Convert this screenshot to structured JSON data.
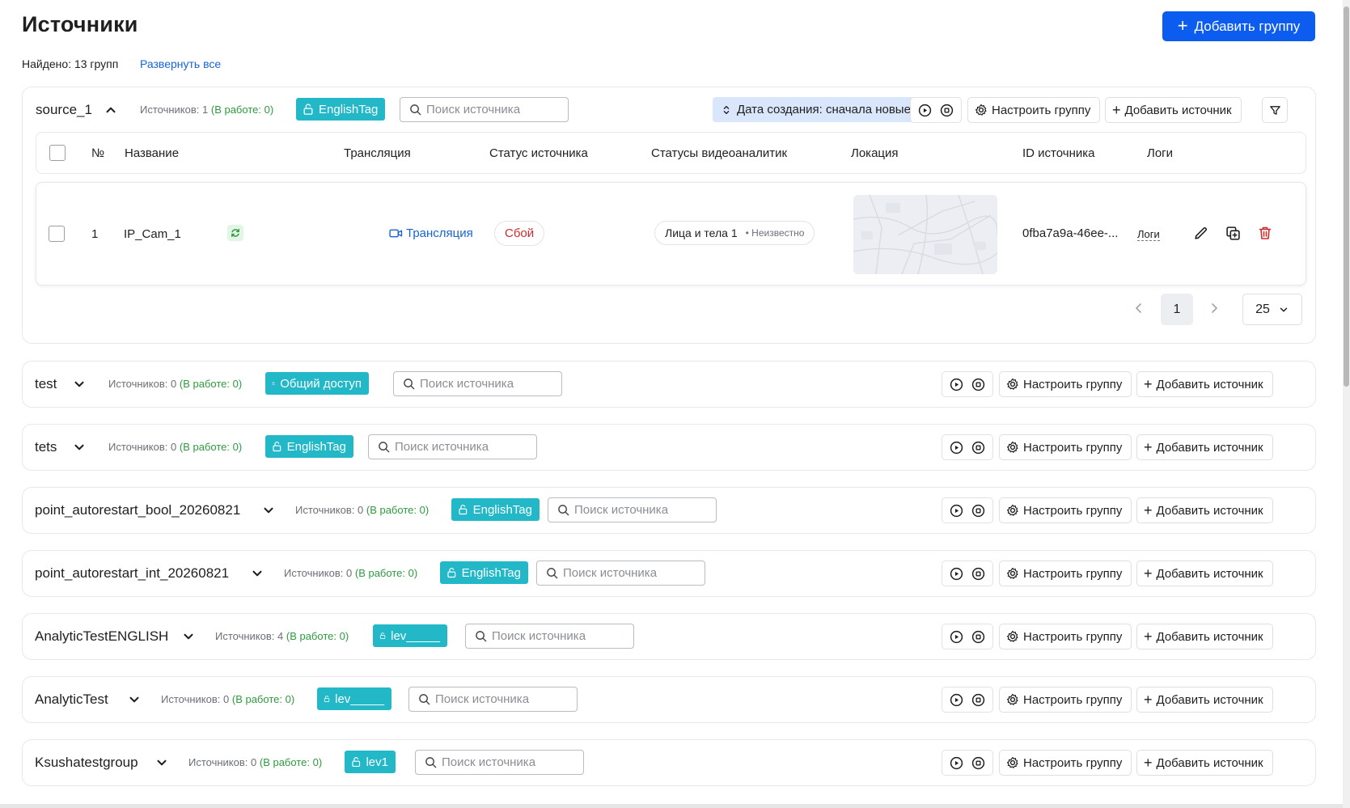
{
  "page": {
    "title": "Источники",
    "add_group_label": "Добавить группу",
    "found_text": "Найдено: 13 групп",
    "expand_all_label": "Развернуть все"
  },
  "common": {
    "search_placeholder": "Поиск источника",
    "configure_label": "Настроить группу",
    "add_source_label": "Добавить источник"
  },
  "colors": {
    "primary": "#0c5cf0",
    "tag": "#23b8c7",
    "working": "#2e9a3e",
    "error": "#d02b2b",
    "link": "#1764d6"
  },
  "expanded_group": {
    "name": "source_1",
    "count_prefix": "Источников: 1",
    "count_working": "(В работе: 0)",
    "tag": "EnglishTag",
    "sort_label": "Дата создания: сначала новые",
    "columns": [
      "№",
      "Название",
      "Трансляция",
      "Статус источника",
      "Статусы видеоаналитик",
      "Локация",
      "ID источника",
      "Логи"
    ],
    "rows": [
      {
        "num": "1",
        "name": "IP_Cam_1",
        "stream": "Трансляция",
        "status": "Сбой",
        "analytic_name": "Лица и тела 1",
        "analytic_status": "Неизвестно",
        "source_id": "0fba7a9a-46ee-...",
        "logs": "Логи"
      }
    ],
    "pagination": {
      "current_page": "1",
      "page_size": "25"
    }
  },
  "groups": [
    {
      "name": "test",
      "count_prefix": "Источников: 0",
      "count_working": "(В работе: 0)",
      "tag": "Общий доступ"
    },
    {
      "name": "tets",
      "count_prefix": "Источников: 0",
      "count_working": "(В работе: 0)",
      "tag": "EnglishTag"
    },
    {
      "name": "point_autorestart_bool_20260821",
      "count_prefix": "Источников: 0",
      "count_working": "(В работе: 0)",
      "tag": "EnglishTag"
    },
    {
      "name": "point_autorestart_int_20260821",
      "count_prefix": "Источников: 0",
      "count_working": "(В работе: 0)",
      "tag": "EnglishTag"
    },
    {
      "name": "AnalyticTestENGLISH",
      "count_prefix": "Источников: 4",
      "count_working": "(В работе: 0)",
      "tag": "lev_____"
    },
    {
      "name": "AnalyticTest",
      "count_prefix": "Источников: 0",
      "count_working": "(В работе: 0)",
      "tag": "lev_____"
    },
    {
      "name": "Ksushatestgroup",
      "count_prefix": "Источников: 0",
      "count_working": "(В работе: 0)",
      "tag": "lev1"
    }
  ]
}
